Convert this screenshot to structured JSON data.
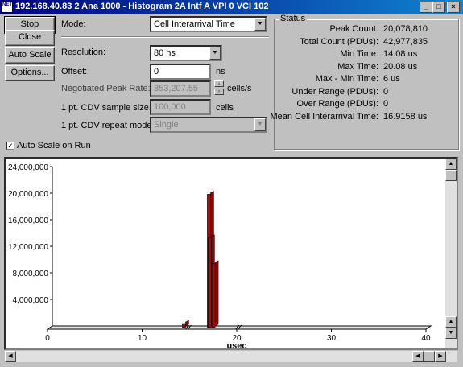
{
  "window": {
    "title": "192.168.40.83 2 Ana 1000 - Histogram 2A  Intf A  VPI   0 VCI 102",
    "icon_text": "NET"
  },
  "buttons": {
    "stop": "Stop",
    "close": "Close",
    "auto_scale": "Auto Scale",
    "options": "Options..."
  },
  "settings": {
    "mode_label": "Mode:",
    "mode_value": "Cell Interarrival Time",
    "resolution_label": "Resolution:",
    "resolution_value": "80 ns",
    "offset_label": "Offset:",
    "offset_value": "0",
    "offset_unit": "ns",
    "peak_rate_label": "Negotiated Peak Rate:",
    "peak_rate_value": "353,207.55",
    "peak_rate_unit": "cells/s",
    "cdv_size_label": "1 pt. CDV sample size:",
    "cdv_size_value": "100,000",
    "cdv_size_unit": "cells",
    "cdv_mode_label": "1 pt. CDV repeat mode:",
    "cdv_mode_value": "Single"
  },
  "status": {
    "title": "Status",
    "rows": [
      {
        "label": "Peak Count:",
        "value": "20,078,810"
      },
      {
        "label": "Total Count (PDUs):",
        "value": "42,977,835"
      },
      {
        "label": "Min Time:",
        "value": "14.08 us"
      },
      {
        "label": "Max Time:",
        "value": "20.08 us"
      },
      {
        "label": "Max - Min Time:",
        "value": "6 us"
      },
      {
        "label": "Under Range (PDUs):",
        "value": "0"
      },
      {
        "label": "Over Range (PDUs):",
        "value": "0"
      },
      {
        "label": "Mean Cell Interarrival Time:",
        "value": "16.9158 us"
      }
    ]
  },
  "auto_scale_on_run": {
    "label": "Auto Scale on Run",
    "checked": true
  },
  "chart_data": {
    "type": "bar",
    "xlabel": "usec",
    "xlim": [
      0,
      40
    ],
    "ylim": [
      0,
      24000000
    ],
    "x_ticks": [
      0,
      10,
      20,
      30,
      40
    ],
    "x_tick_labels": [
      "0",
      "10",
      "20",
      "30",
      "40"
    ],
    "y_ticks": [
      4000000,
      8000000,
      12000000,
      16000000,
      20000000,
      24000000
    ],
    "y_tick_labels": [
      "4,000,000",
      "8,000,000",
      "12,000,000",
      "16,000,000",
      "20,000,000",
      "24,000,000"
    ],
    "bar_color": "#a01010",
    "bars": [
      {
        "x": 14.08,
        "value": 600000
      },
      {
        "x": 16.72,
        "value": 20078810
      },
      {
        "x": 16.8,
        "value": 13500000
      },
      {
        "x": 17.2,
        "value": 9600000
      }
    ]
  }
}
